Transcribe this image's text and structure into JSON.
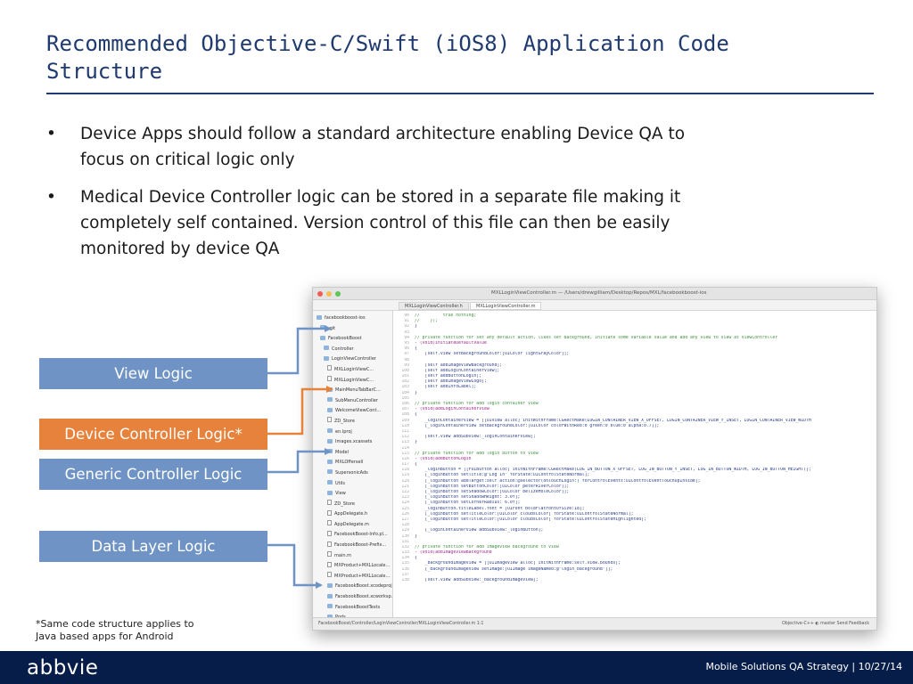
{
  "slide": {
    "title_line1": "Recommended Objective-C/Swift (iOS8) Application Code",
    "title_line2": "Structure",
    "bullets": [
      {
        "marker": "•",
        "line1": "Device Apps should follow a standard architecture enabling Device QA to",
        "line2": "focus on critical logic only",
        "line3": ""
      },
      {
        "marker": "•",
        "line1": "Medical Device Controller logic can be stored in a separate file making it",
        "line2": "completely self contained. Version control of this file can then be easily",
        "line3": "monitored by device QA"
      }
    ],
    "boxes": {
      "view_logic": "View Logic",
      "device_controller": "Device Controller Logic*",
      "generic_controller": "Generic Controller Logic",
      "data_layer": "Data Layer Logic"
    },
    "footnote_line1": "*Same code structure applies to",
    "footnote_line2": "Java based apps for Android",
    "footer": {
      "logo": "abbvie",
      "text": "Mobile Solutions QA Strategy  |  10/27/14"
    }
  },
  "colors": {
    "title": "#1f3a6e",
    "box_blue": "#6e93c4",
    "box_orange": "#e7823c",
    "arrow_blue": "#6e93c4",
    "arrow_orange": "#e7823c",
    "footer_bg": "#071d49"
  },
  "xcode": {
    "titlebar": "MXLLoginViewController.m — /Users/drewgilliam/Desktop/Repos/MXL/facebookboost-ios",
    "tabs": [
      "MXLLoginViewController.h",
      "MXLLoginViewController.m"
    ],
    "navigator": [
      {
        "icon": "folder-icon",
        "label": "facebookboost-ios"
      },
      {
        "icon": "folder-icon",
        "label": ".git"
      },
      {
        "icon": "folder-icon",
        "label": "FacebookBoost"
      },
      {
        "icon": "folder-icon",
        "label": "Controller"
      },
      {
        "icon": "folder-icon",
        "label": "LoginViewController"
      },
      {
        "icon": "file-icon",
        "label": "MXLLoginViewC..."
      },
      {
        "icon": "file-icon",
        "label": "MXLLoginViewC..."
      },
      {
        "icon": "folder-icon",
        "label": "MainMenuTabBarC..."
      },
      {
        "icon": "folder-icon",
        "label": "SubMenuController"
      },
      {
        "icon": "folder-icon",
        "label": "WelcomeViewCont..."
      },
      {
        "icon": "file-icon",
        "label": "ZD_Store"
      },
      {
        "icon": "folder-icon",
        "label": "en.lproj"
      },
      {
        "icon": "folder-icon",
        "label": "Images.xcassets"
      },
      {
        "icon": "folder-icon",
        "label": "Model"
      },
      {
        "icon": "folder-icon",
        "label": "MXLOffersell"
      },
      {
        "icon": "folder-icon",
        "label": "SupersonicAds"
      },
      {
        "icon": "folder-icon",
        "label": "Utils"
      },
      {
        "icon": "folder-icon",
        "label": "View"
      },
      {
        "icon": "file-icon",
        "label": "ZD_Store"
      },
      {
        "icon": "file-icon",
        "label": "AppDelegate.h"
      },
      {
        "icon": "file-icon",
        "label": "AppDelegate.m"
      },
      {
        "icon": "file-icon",
        "label": "FacebookBoost-Info.pl..."
      },
      {
        "icon": "file-icon",
        "label": "FacebookBoost-Prefix..."
      },
      {
        "icon": "file-icon",
        "label": "main.m"
      },
      {
        "icon": "file-icon",
        "label": "MXProduct+MXLLocale..."
      },
      {
        "icon": "file-icon",
        "label": "MXProduct+MXLLocale..."
      },
      {
        "icon": "folder-icon",
        "label": "FacebookBoost.xcodeproj"
      },
      {
        "icon": "folder-icon",
        "label": "FacebookBoost.xcworksp..."
      },
      {
        "icon": "folder-icon",
        "label": "FacebookBoostTests"
      },
      {
        "icon": "folder-icon",
        "label": "Pods"
      },
      {
        "icon": "file-icon",
        "label": "ZD_Store"
      },
      {
        "icon": "file-icon",
        "label": ".gitignore"
      },
      {
        "icon": "file-icon",
        "label": "AppleAccountCertificate..."
      },
      {
        "icon": "file-icon",
        "label": "Podfile"
      }
    ],
    "code": [
      {
        "n": "90",
        "t": "comment",
        "c": "//         true nothing;"
      },
      {
        "n": "91",
        "t": "comment",
        "c": "//    });"
      },
      {
        "n": "92",
        "t": "code",
        "c": "}"
      },
      {
        "n": "93",
        "t": "code",
        "c": ""
      },
      {
        "n": "94",
        "t": "comment",
        "c": "// private function for set any default action, likes set Background, initiate some variable value and add any view to View at ViewController"
      },
      {
        "n": "95",
        "t": "kw",
        "c": "- (void)initiateDefaultValue"
      },
      {
        "n": "96",
        "t": "code",
        "c": "{"
      },
      {
        "n": "97",
        "t": "code",
        "c": "    [self.view setBackgroundColor:[UIColor lightGrayColor]];"
      },
      {
        "n": "98",
        "t": "code",
        "c": ""
      },
      {
        "n": "99",
        "t": "code",
        "c": "    [self addImageViewBackground];"
      },
      {
        "n": "100",
        "t": "code",
        "c": "    [self addLoginContainerView];"
      },
      {
        "n": "101",
        "t": "code",
        "c": "    [self addButtonLogin];"
      },
      {
        "n": "102",
        "t": "code",
        "c": "    [self addImageViewLogo];"
      },
      {
        "n": "103",
        "t": "code",
        "c": "    [self addInfoLabel];"
      },
      {
        "n": "104",
        "t": "code",
        "c": "}"
      },
      {
        "n": "105",
        "t": "code",
        "c": ""
      },
      {
        "n": "106",
        "t": "comment",
        "c": "// private function for add login container view"
      },
      {
        "n": "107",
        "t": "kw",
        "c": "- (void)addLoginContainerView"
      },
      {
        "n": "108",
        "t": "code",
        "c": "{"
      },
      {
        "n": "109",
        "t": "code",
        "c": "    _loginContainerView = [[UIView alloc] initWithFrame:CGRectMake(LOGIN_CONTAINER_VIEW_X_OFFSET, LOGIN_CONTAINER_VIEW_Y_INSET, LOGIN_CONTAINER_VIEW_WIDTH"
      },
      {
        "n": "110",
        "t": "code",
        "c": "    [_loginContainerView setBackgroundColor:[UIColor colorWithRed:0 green:0 blue:0 alpha:0.7]];"
      },
      {
        "n": "111",
        "t": "code",
        "c": ""
      },
      {
        "n": "112",
        "t": "code",
        "c": "    [self.view addSubview:_loginContainerView];"
      },
      {
        "n": "113",
        "t": "code",
        "c": "}"
      },
      {
        "n": "114",
        "t": "code",
        "c": ""
      },
      {
        "n": "115",
        "t": "comment",
        "c": "// private function for add login button to view"
      },
      {
        "n": "116",
        "t": "kw",
        "c": "- (void)addButtonLogin"
      },
      {
        "n": "117",
        "t": "code",
        "c": "{"
      },
      {
        "n": "118",
        "t": "code",
        "c": "    _loginButton = [[FUIButton alloc] initWithFrame:CGRectMake(LOG_IN_BUTTON_X_OFFSET, LOG_IN_BUTTON_Y_INSET, LOG_IN_BUTTON_WIDTH, LOG_IN_BUTTON_HEIGHT)];"
      },
      {
        "n": "119",
        "t": "code",
        "c": "    [_loginButton setTitle:@\"Log In\" forState:UIControlStateNormal];"
      },
      {
        "n": "120",
        "t": "code",
        "c": "    [_loginButton addTarget:self action:@selector(onTouchLogin:) forControlEvents:UIControlEventTouchUpInside];"
      },
      {
        "n": "121",
        "t": "code",
        "c": "    [_loginButton setButtonColor:[UIColor peterRiverColor]];"
      },
      {
        "n": "122",
        "t": "code",
        "c": "    [_loginButton setShadowColor:[UIColor belizeHoleColor]];"
      },
      {
        "n": "123",
        "t": "code",
        "c": "    [_loginButton setShadowHeight: 3.0f];"
      },
      {
        "n": "124",
        "t": "code",
        "c": "    [_loginButton setCornerRadius: 6.0f];"
      },
      {
        "n": "125",
        "t": "code",
        "c": "    _loginButton.titleLabel.font = [UIFont boldFlatFontOfSize:18];"
      },
      {
        "n": "126",
        "t": "code",
        "c": "    [_loginButton setTitleColor:[UIColor cloudsColor] forState:UIControlStateNormal];"
      },
      {
        "n": "127",
        "t": "code",
        "c": "    [_loginButton setTitleColor:[UIColor cloudsColor] forState:UIControlStateHighlighted];"
      },
      {
        "n": "128",
        "t": "code",
        "c": ""
      },
      {
        "n": "129",
        "t": "code",
        "c": "    [_loginContainerView addSubview:_loginButton];"
      },
      {
        "n": "130",
        "t": "code",
        "c": "}"
      },
      {
        "n": "131",
        "t": "code",
        "c": ""
      },
      {
        "n": "132",
        "t": "comment",
        "c": "// private function for add imageview background to view"
      },
      {
        "n": "133",
        "t": "kw",
        "c": "- (void)addImageViewBackground"
      },
      {
        "n": "134",
        "t": "code",
        "c": "{"
      },
      {
        "n": "135",
        "t": "code",
        "c": "    _backgroundImageView = [[UIImageView alloc] initWithFrame:self.view.bounds];"
      },
      {
        "n": "136",
        "t": "code",
        "c": "    [_backgroundImageView setImage:[UIImage imageNamed:@\"login_background\"]];"
      },
      {
        "n": "137",
        "t": "code",
        "c": ""
      },
      {
        "n": "138",
        "t": "code",
        "c": "    [self.view addSubview:_backgroundImageView];"
      }
    ],
    "status_left": "FacebookBoost/Controller/LoginViewController/MXLLoginViewController.m  1:1",
    "status_right": "Objective-C++     ◐ master   Send Feedback"
  }
}
